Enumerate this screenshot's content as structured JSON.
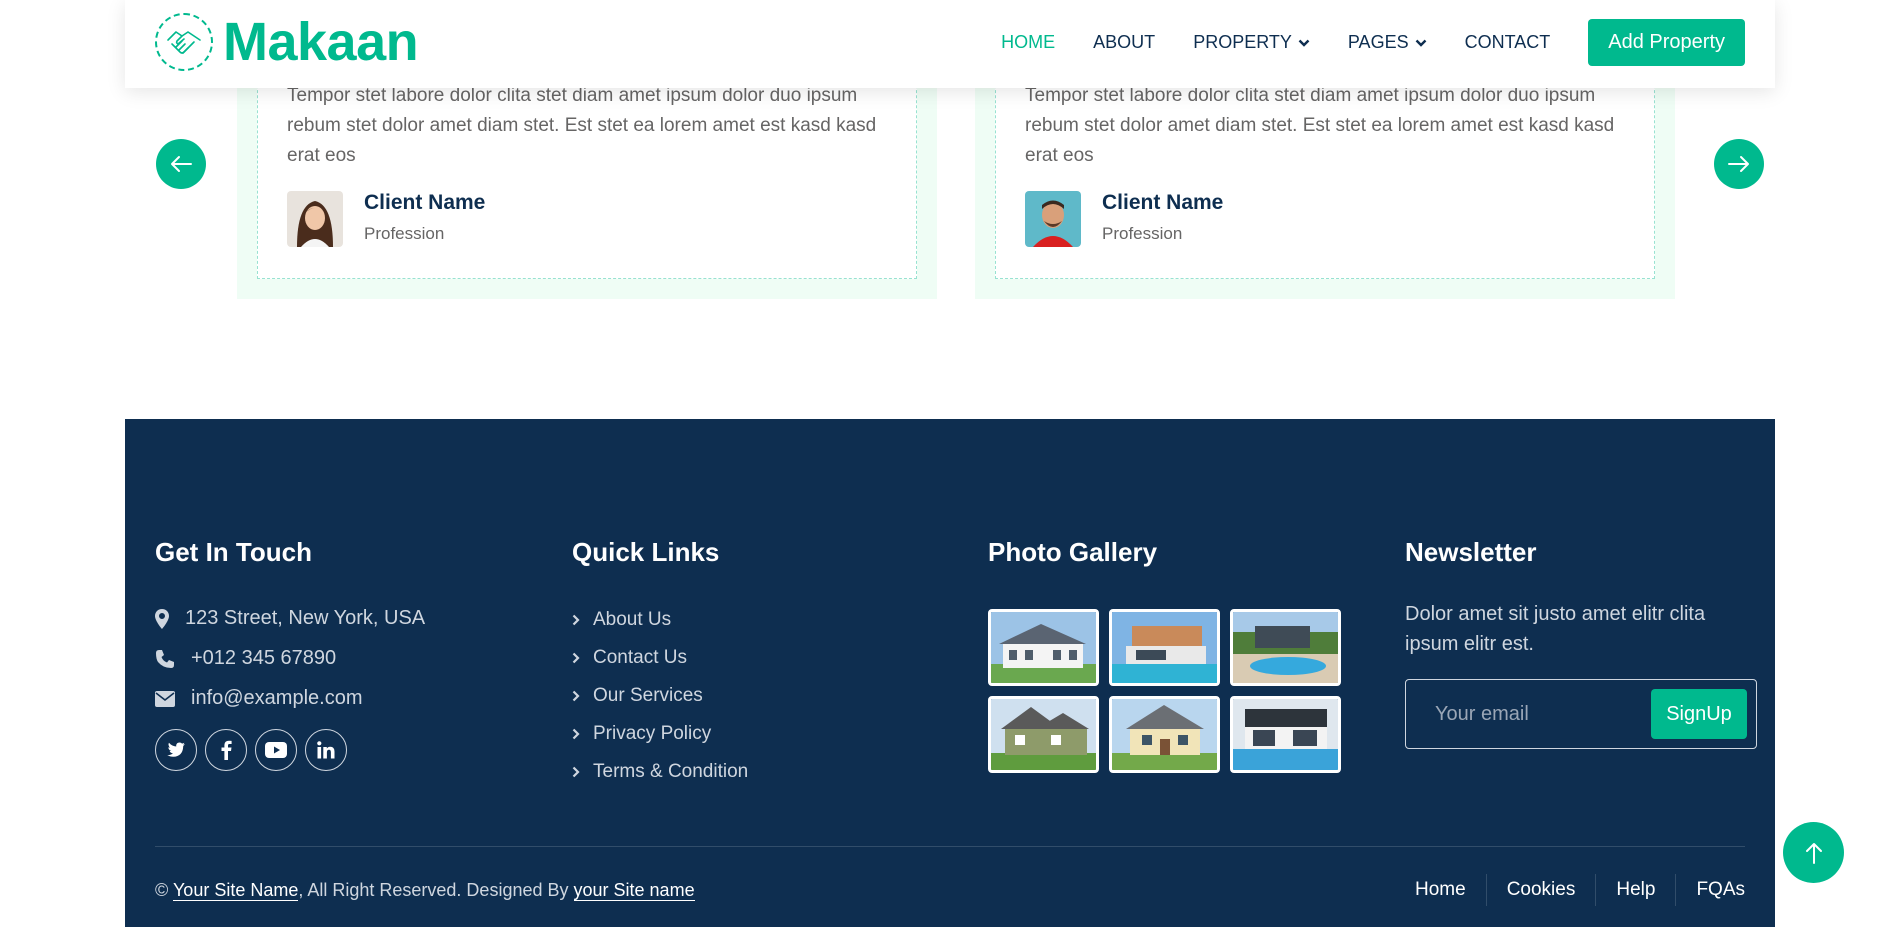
{
  "brand": {
    "name": "Makaan",
    "accent_color": "#00B98E",
    "logo_icon": "handshake-icon"
  },
  "nav": {
    "items": [
      {
        "label": "HOME",
        "active": true
      },
      {
        "label": "ABOUT"
      },
      {
        "label": "PROPERTY",
        "dropdown": true
      },
      {
        "label": "PAGES",
        "dropdown": true
      },
      {
        "label": "CONTACT"
      }
    ],
    "cta": "Add Property"
  },
  "testimonials": [
    {
      "text": "Tempor stet labore dolor clita stet diam amet ipsum dolor duo ipsum rebum stet dolor amet diam stet. Est stet ea lorem amet est kasd kasd erat eos",
      "name": "Client Name",
      "profession": "Profession"
    },
    {
      "text": "Tempor stet labore dolor clita stet diam amet ipsum dolor duo ipsum rebum stet dolor amet diam stet. Est stet ea lorem amet est kasd kasd erat eos",
      "name": "Client Name",
      "profession": "Profession"
    }
  ],
  "footer": {
    "background_color": "#0E2E50",
    "contact": {
      "title": "Get In Touch",
      "address": "123 Street, New York, USA",
      "phone": "+012 345 67890",
      "email": "info@example.com",
      "socials": [
        "twitter-icon",
        "facebook-icon",
        "youtube-icon",
        "linkedin-icon"
      ]
    },
    "quick_links": {
      "title": "Quick Links",
      "items": [
        "About Us",
        "Contact Us",
        "Our Services",
        "Privacy Policy",
        "Terms & Condition"
      ]
    },
    "gallery": {
      "title": "Photo Gallery"
    },
    "newsletter": {
      "title": "Newsletter",
      "text": "Dolor amet sit justo amet elitr clita ipsum elitr est.",
      "placeholder": "Your email",
      "button": "SignUp"
    },
    "copyright": {
      "prefix": "©",
      "site_name": "Your Site Name",
      "middle": ", All Right Reserved. Designed By",
      "designer": "your Site name"
    },
    "menu": [
      "Home",
      "Cookies",
      "Help",
      "FQAs"
    ]
  }
}
